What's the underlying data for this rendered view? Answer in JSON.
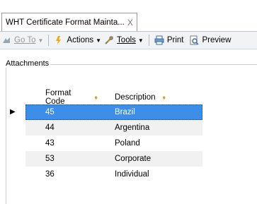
{
  "window": {
    "tab_title": "WHT Certificate Format Mainta...",
    "tab_close": "X"
  },
  "toolbar": {
    "goto_label": "Go To",
    "actions_label": "Actions",
    "tools_label": "Tools",
    "print_label": "Print",
    "preview_label": "Preview"
  },
  "section": {
    "attachments_label": "Attachments"
  },
  "grid": {
    "columns": [
      "Format Code",
      "Description"
    ],
    "rows": [
      {
        "code": "45",
        "description": "Brazil"
      },
      {
        "code": "44",
        "description": "Argentina"
      },
      {
        "code": "43",
        "description": "Poland"
      },
      {
        "code": "53",
        "description": "Corporate"
      },
      {
        "code": "36",
        "description": "Individual"
      }
    ],
    "selected_row_index": 0
  },
  "colors": {
    "selection": "#3d8ee8",
    "alt_row": "#f1f1f1",
    "sort_indicator": "#c9a227"
  },
  "icons": [
    "goto-icon",
    "actions-icon",
    "tools-icon",
    "print-icon",
    "preview-icon",
    "row-indicator-icon",
    "sort-icon"
  ]
}
